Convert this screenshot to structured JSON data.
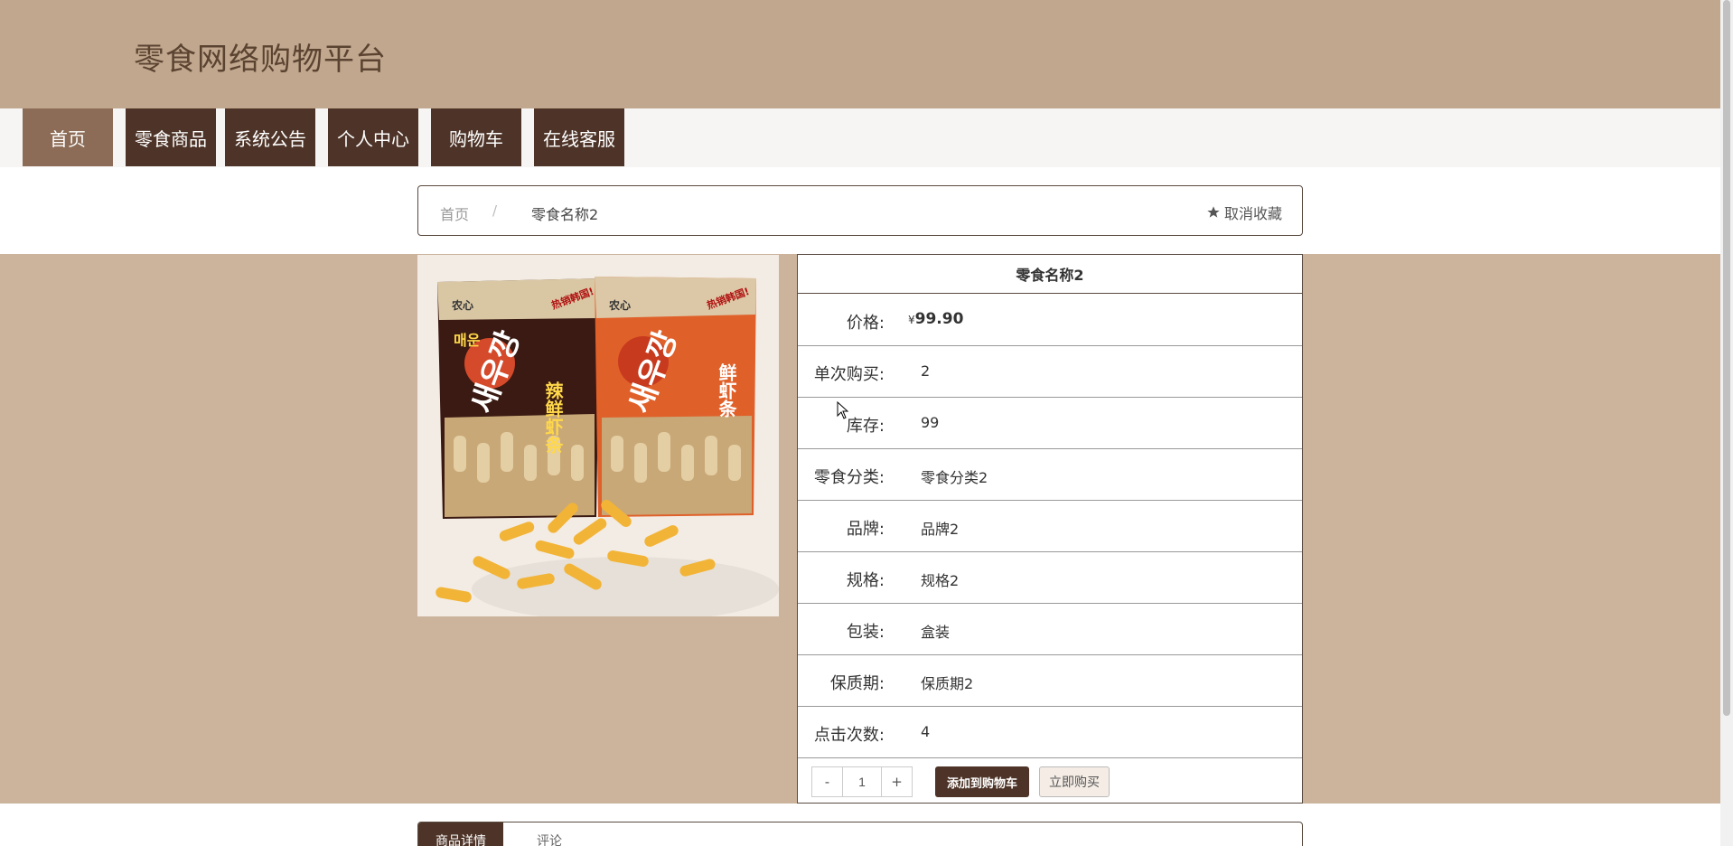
{
  "site": {
    "title": "零食网络购物平台"
  },
  "nav": {
    "items": [
      {
        "label": "首页",
        "active": true
      },
      {
        "label": "零食商品"
      },
      {
        "label": "系统公告"
      },
      {
        "label": "个人中心"
      },
      {
        "label": "购物车"
      },
      {
        "label": "在线客服"
      }
    ]
  },
  "breadcrumb": {
    "home": "首页",
    "separator": "/",
    "current": "零食名称2",
    "favorite_label": "取消收藏"
  },
  "product": {
    "name": "零食名称2",
    "currency": "¥",
    "price": "99.90",
    "rows": [
      {
        "label": "单次购买:",
        "value": "2"
      },
      {
        "label": "库存:",
        "value": "99"
      },
      {
        "label": "零食分类:",
        "value": "零食分类2"
      },
      {
        "label": "品牌:",
        "value": "品牌2"
      },
      {
        "label": "规格:",
        "value": "规格2"
      },
      {
        "label": "包装:",
        "value": "盒装"
      },
      {
        "label": "保质期:",
        "value": "保质期2"
      },
      {
        "label": "点击次数:",
        "value": "4"
      }
    ],
    "price_label": "价格:",
    "quantity": "1",
    "minus": "-",
    "plus": "+",
    "add_to_cart": "添加到购物车",
    "buy_now": "立即购买",
    "image_text": {
      "brand": "农心",
      "badge": "热销韩国!",
      "left_korean_top": "매운",
      "korean_name": "새우깡",
      "left_cn": "辣鲜虾条",
      "right_cn": "鲜虾条"
    }
  },
  "tabs": {
    "detail": "商品详情",
    "comments": "评论"
  },
  "colors": {
    "header": "#c0a78d",
    "nav_dark": "#4e3428",
    "nav_active": "#8c6c56",
    "band": "#cbb39c"
  }
}
